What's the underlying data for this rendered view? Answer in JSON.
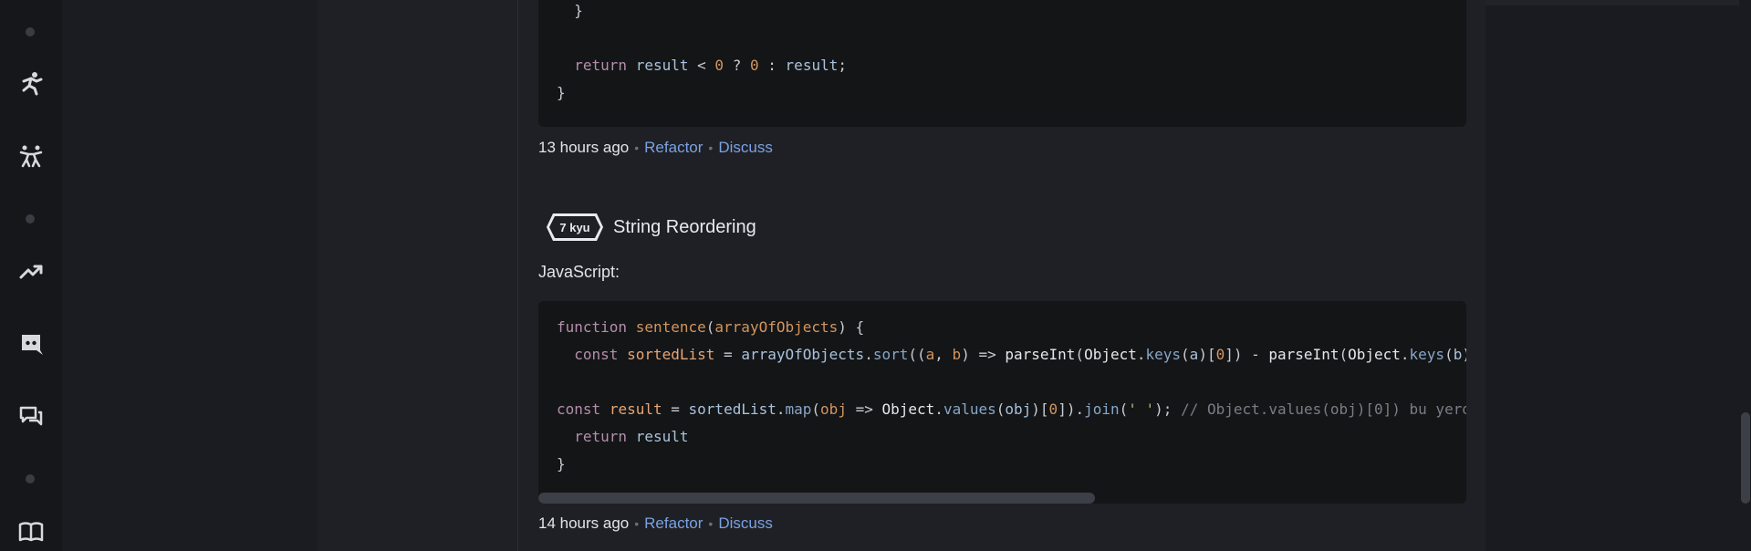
{
  "colors": {
    "background": "#1f2025",
    "code_bg": "#141517",
    "link": "#7aa2e3",
    "rail": "#16171b"
  },
  "rail": {
    "icons": [
      "dot",
      "practice-figure-icon",
      "dojo-fighters-icon",
      "dot",
      "trending-icon",
      "discord-icon",
      "forum-chat-icon",
      "dot",
      "docs-book-icon"
    ]
  },
  "solutions": [
    {
      "code_lines": [
        "  }",
        "",
        "  return result < 0 ? 0 : result;",
        "}"
      ],
      "time": "13 hours ago",
      "actions": [
        "Refactor",
        "Discuss"
      ]
    },
    {
      "rank": "7 kyu",
      "title": "String Reordering",
      "language": "JavaScript:",
      "code_lines": [
        "function sentence(arrayOfObjects) {",
        "  const sortedList = arrayOfObjects.sort((a, b) => parseInt(Object.keys(a)[0]) - parseInt(Object.keys(b)",
        "",
        "const result = sortedList.map(obj => Object.values(obj)[0]).join(' '); // Object.values(obj)[0]) bu yerd",
        "  return result",
        "}"
      ],
      "time": "14 hours ago",
      "actions": [
        "Refactor",
        "Discuss"
      ]
    }
  ]
}
